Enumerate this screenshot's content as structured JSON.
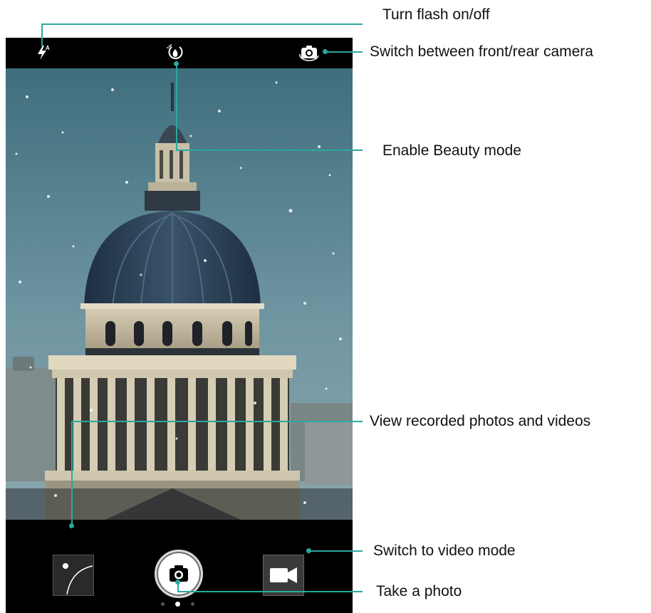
{
  "callouts": {
    "flash": "Turn flash on/off",
    "switch_camera": "Switch between front/rear camera",
    "beauty": "Enable Beauty mode",
    "gallery": "View recorded photos and videos",
    "video": "Switch to video mode",
    "photo": "Take a photo"
  },
  "colors": {
    "callout_line": "#2aa8a0",
    "sky": "#5f8694",
    "dome": "#2c4357"
  },
  "icons": {
    "flash": "flash-auto-icon",
    "beauty": "beauty-mode-icon",
    "switch_camera": "camera-switch-icon",
    "gallery": "gallery-thumbnail-icon",
    "shutter": "camera-icon",
    "video": "video-camera-icon"
  },
  "pager": {
    "count": 3,
    "active_index": 1
  }
}
